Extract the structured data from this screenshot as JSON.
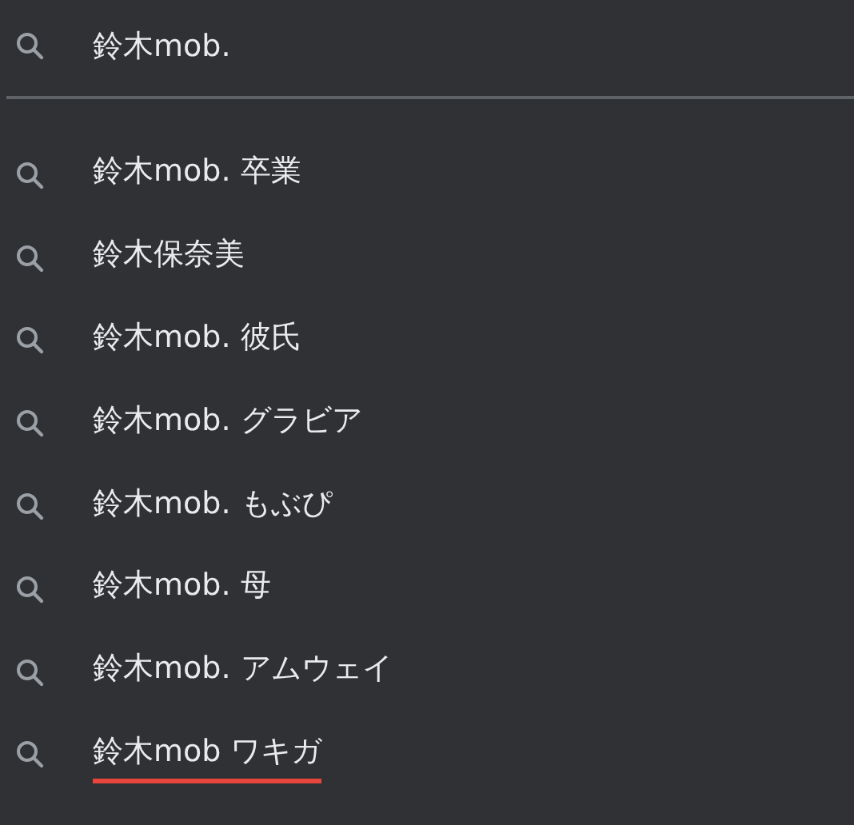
{
  "search": {
    "value": "鈴木mob."
  },
  "suggestions": [
    {
      "text": "鈴木mob. 卒業",
      "underlined": false
    },
    {
      "text": "鈴木保奈美",
      "underlined": false
    },
    {
      "text": "鈴木mob. 彼氏",
      "underlined": false
    },
    {
      "text": "鈴木mob. グラビア",
      "underlined": false
    },
    {
      "text": "鈴木mob. もぶぴ",
      "underlined": false
    },
    {
      "text": "鈴木mob. 母",
      "underlined": false
    },
    {
      "text": "鈴木mob. アムウェイ",
      "underlined": false
    },
    {
      "text": "鈴木mob ワキガ",
      "underlined": true
    }
  ]
}
